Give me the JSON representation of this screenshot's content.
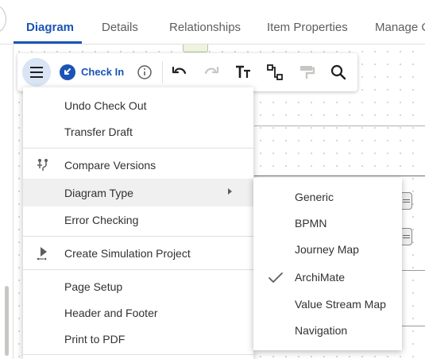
{
  "tabs": [
    {
      "label": "Diagram",
      "active": true
    },
    {
      "label": "Details",
      "active": false
    },
    {
      "label": "Relationships",
      "active": false
    },
    {
      "label": "Item Properties",
      "active": false
    },
    {
      "label": "Manage C",
      "active": false
    }
  ],
  "toolbar": {
    "menu_icon": "hamburger-menu-icon",
    "check_in_label": "Check In",
    "check_in_icon": "arrow-down-left-circle-icon",
    "info_icon": "info-icon",
    "undo_icon": "undo-icon",
    "redo_icon": "redo-icon",
    "text_format_icon": "text-size-icon",
    "connector_icon": "connector-icon",
    "format_painter_icon": "format-painter-icon",
    "search_icon": "search-icon"
  },
  "menu": {
    "undo_check_out": "Undo Check Out",
    "transfer_draft": "Transfer Draft",
    "compare_versions": "Compare Versions",
    "diagram_type": "Diagram Type",
    "error_checking": "Error Checking",
    "create_simulation_project": "Create Simulation Project",
    "page_setup": "Page Setup",
    "header_and_footer": "Header and Footer",
    "print_to_pdf": "Print to PDF"
  },
  "diagram_type_submenu": {
    "items": [
      "Generic",
      "BPMN",
      "Journey Map",
      "ArchiMate",
      "Value Stream Map",
      "Navigation"
    ],
    "selected": "ArchiMate"
  },
  "colors": {
    "accent": "#1a54b5",
    "toolbar_highlight": "#d9e4f5",
    "menu_hover": "#f0f0f0"
  }
}
